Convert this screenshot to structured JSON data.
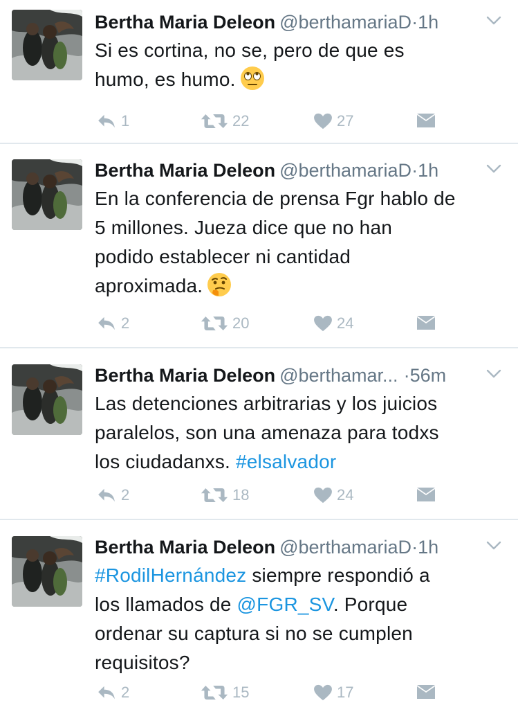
{
  "tweets": [
    {
      "name": "Bertha Maria Deleon",
      "handle": "@berthamariaD",
      "separator": "·",
      "time": "1h",
      "text_parts": [
        "Si es cortina, no se, pero de que es",
        "humo, es humo."
      ],
      "emoji": "eye-roll-emoji",
      "replies": "1",
      "retweets": "22",
      "likes": "27"
    },
    {
      "name": "Bertha Maria Deleon",
      "handle": "@berthamariaD",
      "separator": "·",
      "time": "1h",
      "text_parts": [
        "En la conferencia de prensa Fgr hablo de",
        "5 millones. Jueza dice que no han",
        "podido establecer ni cantidad",
        "aproximada."
      ],
      "emoji": "thinking-face-emoji",
      "replies": "2",
      "retweets": "20",
      "likes": "24"
    },
    {
      "name": "Bertha Maria Deleon",
      "handle": "@berthamar...",
      "separator": "·",
      "time": "56m",
      "text_parts": [
        "Las detenciones arbitrarias y los juicios",
        "paralelos, son una amenaza para todxs",
        "los ciudadanxs. "
      ],
      "hashtag": "#elsalvador",
      "replies": "2",
      "retweets": "18",
      "likes": "24"
    },
    {
      "name": "Bertha Maria Deleon",
      "handle": "@berthamariaD",
      "separator": "·",
      "time": "1h",
      "hashtag": "#RodilHernández",
      "text_parts": [
        " siempre respondió a",
        "los llamados de ",
        ". Porque",
        "ordenar su captura si no se cumplen",
        "requisitos?"
      ],
      "mention": "@FGR_SV",
      "replies": "2",
      "retweets": "15",
      "likes": "17"
    }
  ],
  "colors": {
    "text": "#14171a",
    "secondary": "#657786",
    "link": "#1b95e0",
    "action": "#aab8c2",
    "divider": "#e1e8ed"
  }
}
